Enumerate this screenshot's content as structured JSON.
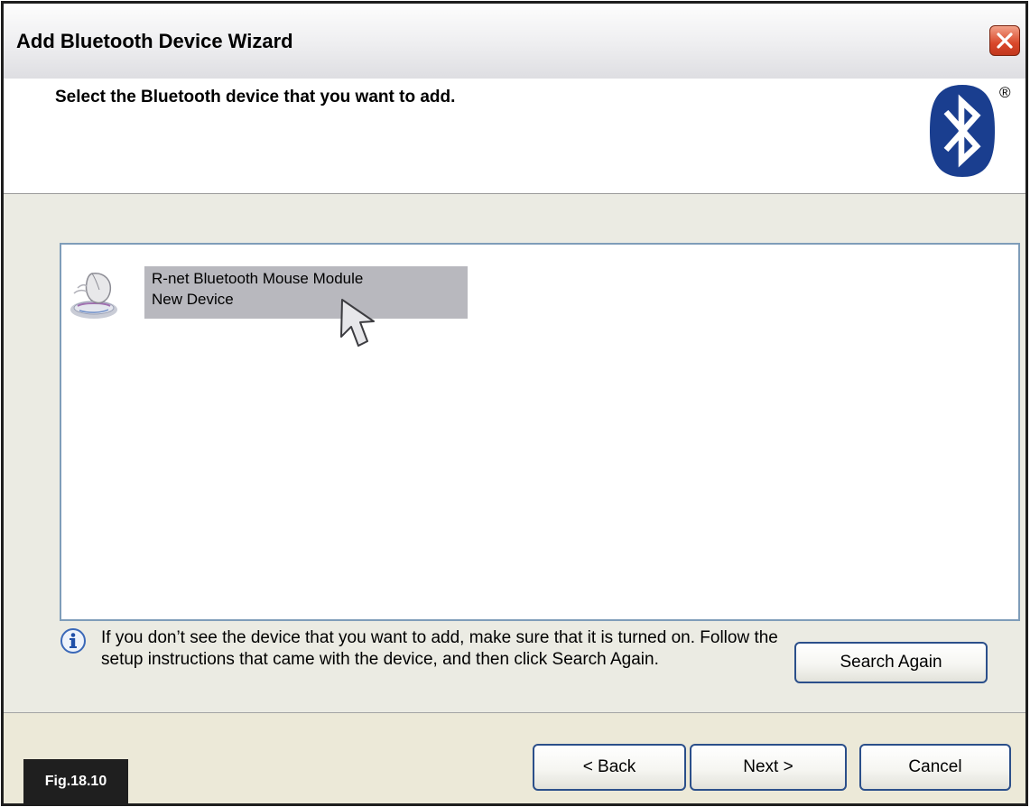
{
  "window": {
    "title": "Add Bluetooth Device Wizard",
    "close_icon": "close-icon"
  },
  "header": {
    "heading": "Select the Bluetooth device that you want to add.",
    "logo": "bluetooth-logo-icon",
    "registered_mark": "®"
  },
  "devices": [
    {
      "name": "R-net Bluetooth Mouse Module",
      "status": "New Device",
      "icon": "mouse-device-icon",
      "selected": true
    }
  ],
  "info": {
    "icon": "info-icon",
    "text": "If you don’t see the device that you want to add, make sure that it is turned on. Follow the setup instructions that came with the device, and then click Search Again."
  },
  "buttons": {
    "search_again": "Search Again",
    "back": "< Back",
    "next": "Next >",
    "cancel": "Cancel"
  },
  "figure_label": "Fig.18.10",
  "colors": {
    "list_border": "#7f9db9",
    "selection": "#b8b8be",
    "button_border": "#2b4f8a",
    "close_button": "#d9472a",
    "bluetooth_blue": "#1a3e8f"
  }
}
